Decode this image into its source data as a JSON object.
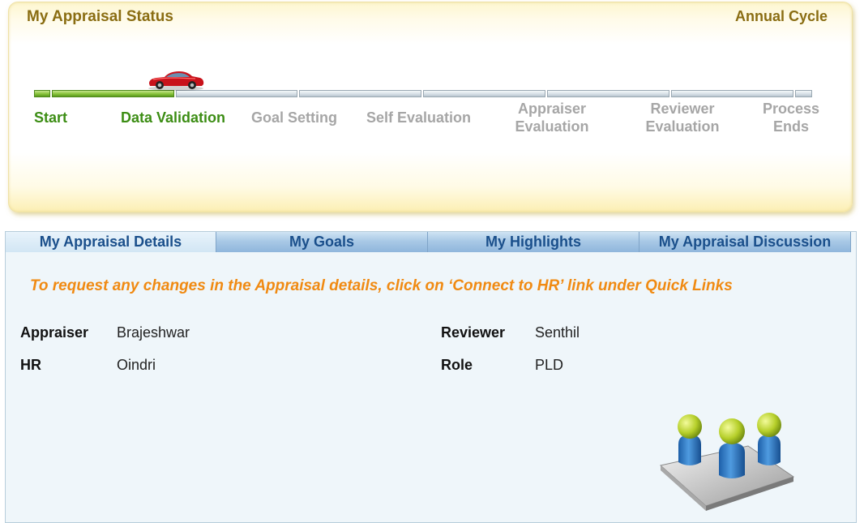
{
  "status": {
    "title": "My Appraisal Status",
    "cycle": "Annual Cycle",
    "current_stage_index": 1,
    "stages": [
      {
        "line1": "Start",
        "line2": "",
        "state": "done"
      },
      {
        "line1": "Data Validation",
        "line2": "",
        "state": "done"
      },
      {
        "line1": "Goal Setting",
        "line2": "",
        "state": "pending"
      },
      {
        "line1": "Self Evaluation",
        "line2": "",
        "state": "pending"
      },
      {
        "line1": "Appraiser",
        "line2": "Evaluation",
        "state": "pending"
      },
      {
        "line1": "Reviewer",
        "line2": "Evaluation",
        "state": "pending"
      },
      {
        "line1": "Process",
        "line2": "Ends",
        "state": "pending"
      }
    ]
  },
  "tabs": [
    {
      "label": "My Appraisal Details",
      "active": true
    },
    {
      "label": "My Goals",
      "active": false
    },
    {
      "label": "My Highlights",
      "active": false
    },
    {
      "label": "My Appraisal Discussion",
      "active": false
    }
  ],
  "notice": "To request any changes in the Appraisal details, click on ‘Connect to HR’ link under Quick Links",
  "details": {
    "appraiser_label": "Appraiser",
    "appraiser_value": "Brajeshwar",
    "reviewer_label": "Reviewer",
    "reviewer_value": "Senthil",
    "hr_label": "HR",
    "hr_value": "Oindri",
    "role_label": "Role",
    "role_value": "PLD"
  },
  "colors": {
    "done_stage": "#3c8d14",
    "pending_stage": "#a6a6a6",
    "title": "#8a6d12",
    "notice": "#f08a12",
    "tab_text": "#1a4f8b"
  },
  "icons": {
    "progress_marker": "car-icon",
    "details_illustration": "team-icon"
  }
}
